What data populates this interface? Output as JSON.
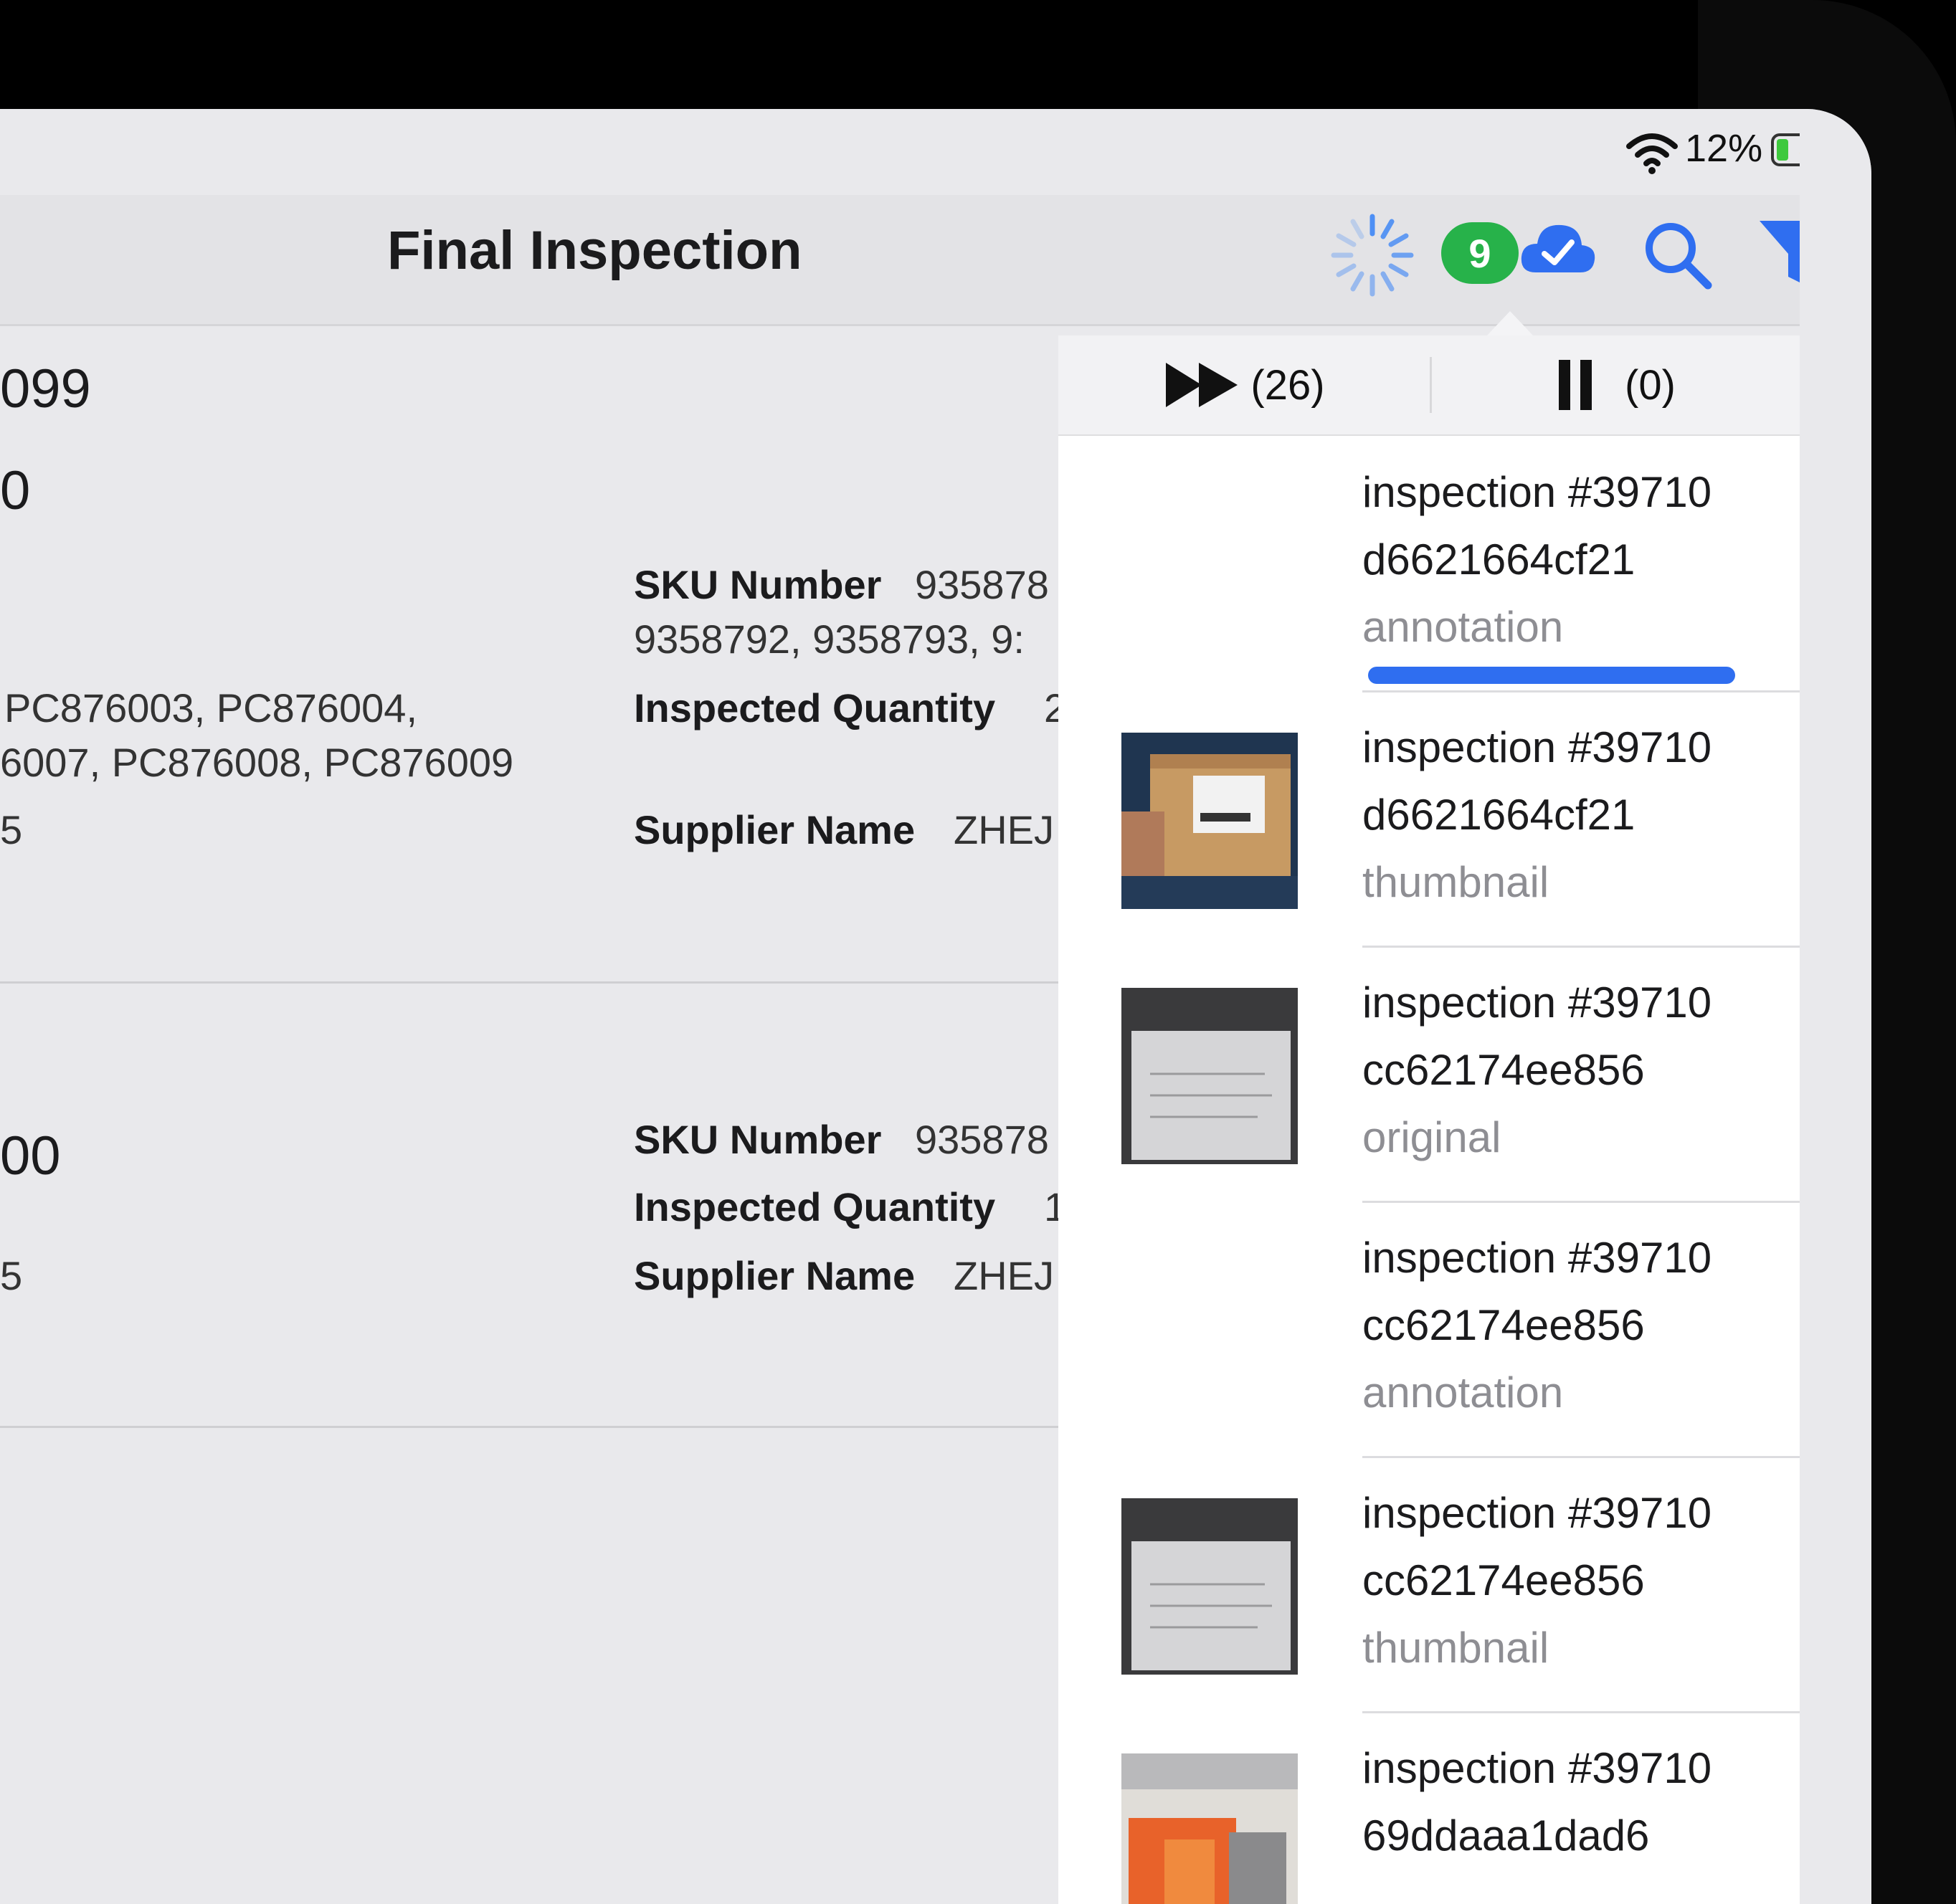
{
  "status_bar": {
    "battery_percent": "12%",
    "battery_level": 0.12,
    "charging": true
  },
  "nav": {
    "title": "Final Inspection",
    "sync_badge_count": "9",
    "icons": [
      "activity-spinner-icon",
      "cloud-check-icon",
      "search-icon",
      "filter-icon"
    ]
  },
  "list": {
    "row1": {
      "num_a": "099",
      "num_b": "0",
      "codes_line1": "PC876003, PC876004,",
      "codes_line2": "6007, PC876008, PC876009",
      "num_c": "5",
      "sku_label": "SKU Number",
      "sku_value": "935878",
      "sku_line2": "9358792, 9358793, 9:",
      "qty_label": "Inspected Quantity",
      "qty_value": "2",
      "supplier_label": "Supplier Name",
      "supplier_value": "ZHEJ"
    },
    "row2": {
      "num_a": "00",
      "num_c": "5",
      "sku_label": "SKU Number",
      "sku_value": "935878",
      "qty_label": "Inspected Quantity",
      "qty_value": "1",
      "supplier_label": "Supplier Name",
      "supplier_value": "ZHEJ"
    }
  },
  "upload_popover": {
    "queue": {
      "running_count": "(26)",
      "paused_count": "(0)"
    },
    "items": [
      {
        "title": "inspection #39710",
        "id": "d6621664cf21",
        "type": "annotation",
        "has_thumb": false,
        "progress": 1.0
      },
      {
        "title": "inspection #39710",
        "id": "d6621664cf21",
        "type": "thumbnail",
        "has_thumb": true,
        "thumb": "box-photo"
      },
      {
        "title": "inspection #39710",
        "id": "cc62174ee856",
        "type": "original",
        "has_thumb": true,
        "thumb": "document-photo"
      },
      {
        "title": "inspection #39710",
        "id": "cc62174ee856",
        "type": "annotation",
        "has_thumb": false
      },
      {
        "title": "inspection #39710",
        "id": "cc62174ee856",
        "type": "thumbnail",
        "has_thumb": true,
        "thumb": "document-photo"
      },
      {
        "title": "inspection #39710",
        "id": "69ddaaa1dad6",
        "type": "",
        "has_thumb": true,
        "thumb": "orange-package-photo"
      }
    ]
  },
  "colors": {
    "accent": "#2f6ef0",
    "badge_green": "#27b24a",
    "secondary_text": "#8e8e93"
  }
}
